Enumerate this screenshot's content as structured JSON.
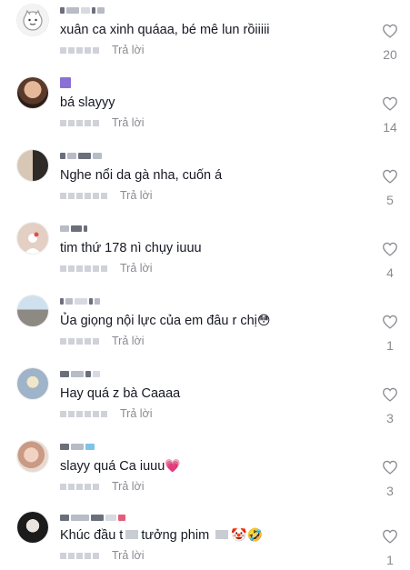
{
  "reply_label": "Trả lời",
  "colors": {
    "text": "#161823",
    "meta": "#8a8b91",
    "heart_outline": "#8a8b91"
  },
  "comments": [
    {
      "text": "xuân ca xinh quáaa, bé mê lun rồiiiii",
      "likes": "20",
      "avatar": "cartoon-avatar"
    },
    {
      "text": "bá slayyy",
      "likes": "14",
      "avatar": "photo-avatar"
    },
    {
      "text": "Nghe nổi da gà nha, cuốn á",
      "likes": "5",
      "avatar": "photo-avatar"
    },
    {
      "text": "tim thứ 178 nì chụy iuuu",
      "likes": "4",
      "avatar": "default-avatar"
    },
    {
      "text": "Ủa giọng nội lực của em đâu r chị",
      "emoji": "😳",
      "likes": "1",
      "avatar": "photo-avatar"
    },
    {
      "text": "Hay quá z bà Caaaa",
      "likes": "3",
      "avatar": "photo-avatar"
    },
    {
      "text": "slayy quá Ca iuuu",
      "emoji": "💗",
      "likes": "3",
      "avatar": "photo-avatar"
    },
    {
      "text": "Khúc đầu t",
      "text_tail": "tưởng phim",
      "emoji": "🤡🤣",
      "likes": "1",
      "avatar": "photo-avatar"
    }
  ]
}
